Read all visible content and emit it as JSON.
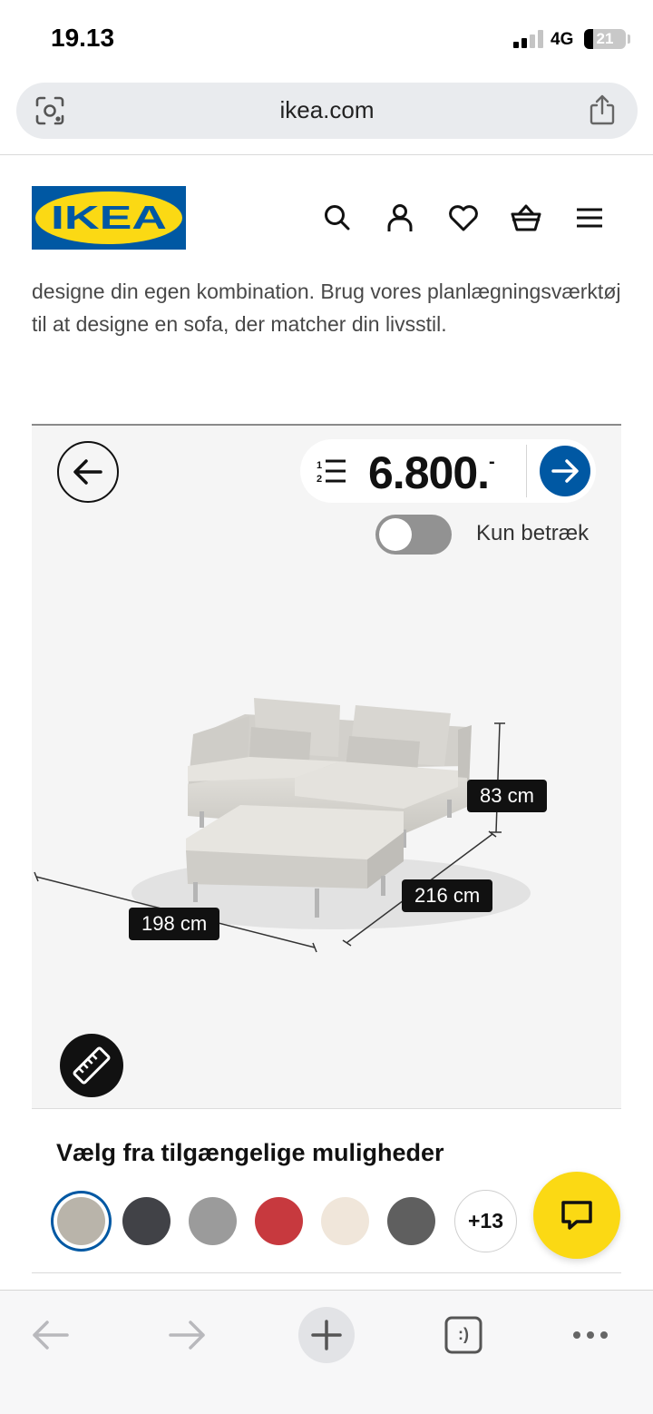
{
  "status_bar": {
    "time": "19.13",
    "network": "4G",
    "battery": "21"
  },
  "browser": {
    "url": "ikea.com"
  },
  "header": {
    "logo_text": "IKEA",
    "icons": [
      "search-icon",
      "account-icon",
      "heart-icon",
      "basket-icon",
      "menu-icon"
    ]
  },
  "intro": {
    "text": "designe din egen kombination. Brug vores planlægningsværktøj til at designe en sofa, der matcher din livsstil."
  },
  "planner": {
    "price": "6.800.",
    "price_suffix": "-",
    "toggle_label": "Kun betræk",
    "toggle_on": false,
    "dimensions": {
      "height": "83 cm",
      "depth": "216 cm",
      "width": "198 cm"
    },
    "colors": {
      "accent": "#0058a3",
      "fabric": "#dcdad5"
    }
  },
  "options": {
    "title": "Vælg fra tilgængelige muligheder",
    "swatches": [
      {
        "name": "beige-grey",
        "color": "#b9b4aa",
        "selected": true
      },
      {
        "name": "dark-grey",
        "color": "#414247",
        "selected": false
      },
      {
        "name": "medium-grey",
        "color": "#9b9b9b",
        "selected": false
      },
      {
        "name": "red",
        "color": "#c7393e",
        "selected": false
      },
      {
        "name": "cream",
        "color": "#f0e6da",
        "selected": false
      },
      {
        "name": "charcoal",
        "color": "#5f5f5f",
        "selected": false
      }
    ],
    "more_label": "+13"
  },
  "chat": {
    "color": "#fbd914",
    "icon": "chat-icon"
  },
  "toolbar": {
    "icons": [
      "back-arrow-icon",
      "forward-arrow-icon",
      "plus-icon",
      "tabs-icon",
      "more-icon"
    ],
    "tabs_glyph": ":)"
  }
}
